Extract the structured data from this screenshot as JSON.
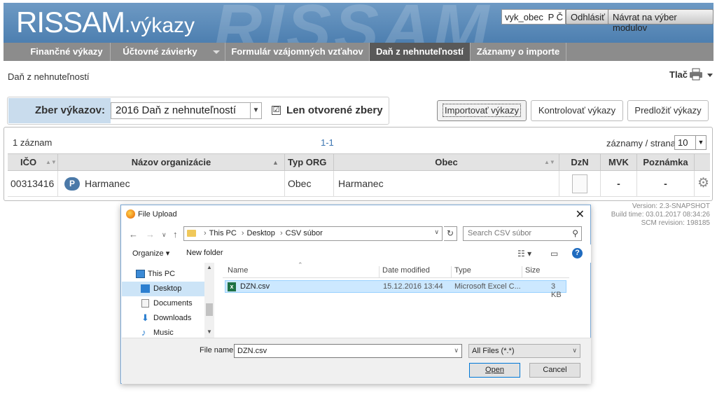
{
  "header": {
    "logo": "RISSAM",
    "logo_suffix": ".výkazy",
    "watermark": "RISSAM",
    "user_value": "vyk_obec",
    "user_badge": "P Č",
    "logout": "Odhlásiť",
    "back_to_modules": "Návrat na výber modulov"
  },
  "nav": [
    {
      "label": "Finančné výkazy"
    },
    {
      "label": "Účtovné závierky"
    },
    {
      "label": "Formulár vzájomných vzťahov"
    },
    {
      "label": "Daň z nehnuteľností",
      "active": true
    },
    {
      "label": "Záznamy o importe"
    }
  ],
  "page": {
    "title": "Daň z nehnuteľností",
    "print": "Tlač"
  },
  "filter": {
    "label": "Zber výkazov:",
    "selected": "2016 Daň z nehnuteľností",
    "checkbox_mark": "☑",
    "checkbox_label": "Len otvorené zbery",
    "checked": true
  },
  "actions": {
    "import": "Importovať výkazy",
    "check": "Kontrolovať výkazy",
    "submit": "Predložiť výkazy"
  },
  "table": {
    "count": "1 záznam",
    "range": "1-1",
    "per_page_label": "záznamy / strana",
    "per_page": "10",
    "columns": {
      "ico": "IČO",
      "name": "Názov organizácie",
      "type": "Typ ORG",
      "city": "Obec",
      "dzn": "DzN",
      "mvk": "MVK",
      "note": "Poznámka"
    },
    "rows": [
      {
        "ico": "00313416",
        "badge": "P",
        "name": "Harmanec",
        "type": "Obec",
        "city": "Harmanec",
        "mvk": "-",
        "note": "-"
      }
    ]
  },
  "build": {
    "version": "Version: 2.3-SNAPSHOT",
    "time": "Build time: 03.01.2017 08:34:26",
    "scm": "SCM revision: 198185"
  },
  "dialog": {
    "title": "File Upload",
    "path": [
      "This PC",
      "Desktop",
      "CSV súbor"
    ],
    "search_placeholder": "Search CSV súbor",
    "organize": "Organize ▾",
    "new_folder": "New folder",
    "tree": [
      {
        "label": "This PC",
        "icon": "computer-icon"
      },
      {
        "label": "Desktop",
        "icon": "desktop-icon",
        "selected": true
      },
      {
        "label": "Documents",
        "icon": "documents-icon"
      },
      {
        "label": "Downloads",
        "icon": "downloads-icon"
      },
      {
        "label": "Music",
        "icon": "music-icon"
      }
    ],
    "columns": {
      "name": "Name",
      "date": "Date modified",
      "type": "Type",
      "size": "Size"
    },
    "files": [
      {
        "name": "DZN.csv",
        "date": "15.12.2016 13:44",
        "type": "Microsoft Excel C...",
        "size": "3 KB"
      }
    ],
    "file_name_label": "File name:",
    "file_name_value": "DZN.csv",
    "file_type": "All Files (*.*)",
    "open": "Open",
    "cancel": "Cancel"
  },
  "colors": {
    "header": "#5b8bbb",
    "nav": "#8c8c8c",
    "nav_active": "#595959",
    "filter_label_bg": "#c9dced"
  }
}
